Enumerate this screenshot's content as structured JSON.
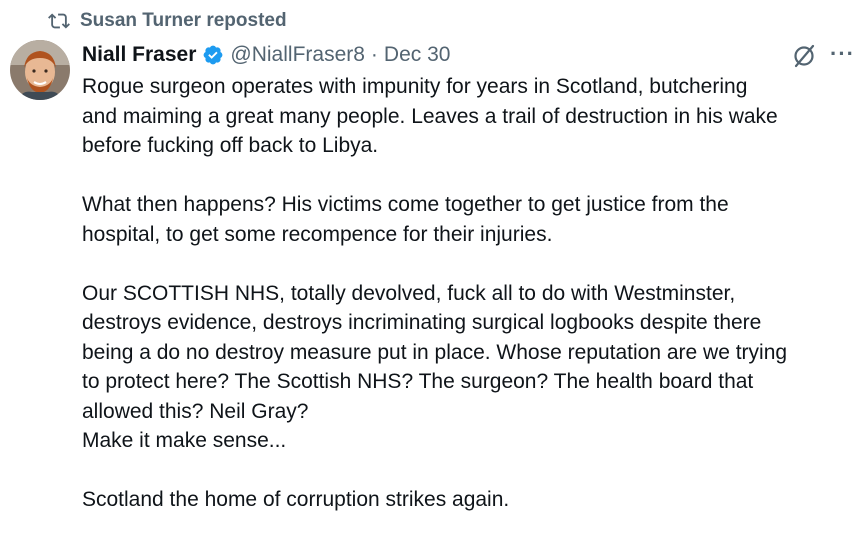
{
  "repost": {
    "label": "Susan Turner reposted",
    "icon": "repost-icon"
  },
  "author": {
    "name": "Niall Fraser",
    "handle": "@NiallFraser8",
    "separator": "·",
    "date": "Dec 30",
    "verified_color": "#1d9bf0"
  },
  "actions": {
    "grok_icon": "grok-icon",
    "more_label": "···"
  },
  "tweet": {
    "p1_l1": "Rogue surgeon operates with impunity for years in Scotland, butchering",
    "p1_l2": "and maiming a great many people. Leaves a trail of destruction in his wake",
    "p1_l3": "before fucking off back to Libya.",
    "p2_l1": "What then happens? His victims come together to get justice from the",
    "p2_l2": "hospital, to get some recompence for their injuries.",
    "p3_l1": "Our SCOTTISH NHS, totally devolved, fuck all to do with Westminster,",
    "p3_l2": "destroys evidence, destroys incriminating surgical logbooks despite there",
    "p3_l3": "being a do no destroy measure put in place. Whose reputation are we trying",
    "p3_l4": "to protect here? The Scottish NHS? The surgeon? The health board that",
    "p3_l5": "allowed this? Neil Gray?",
    "p3_l6": "Make it make sense...",
    "p4_l1": "Scotland the home of corruption strikes again."
  }
}
